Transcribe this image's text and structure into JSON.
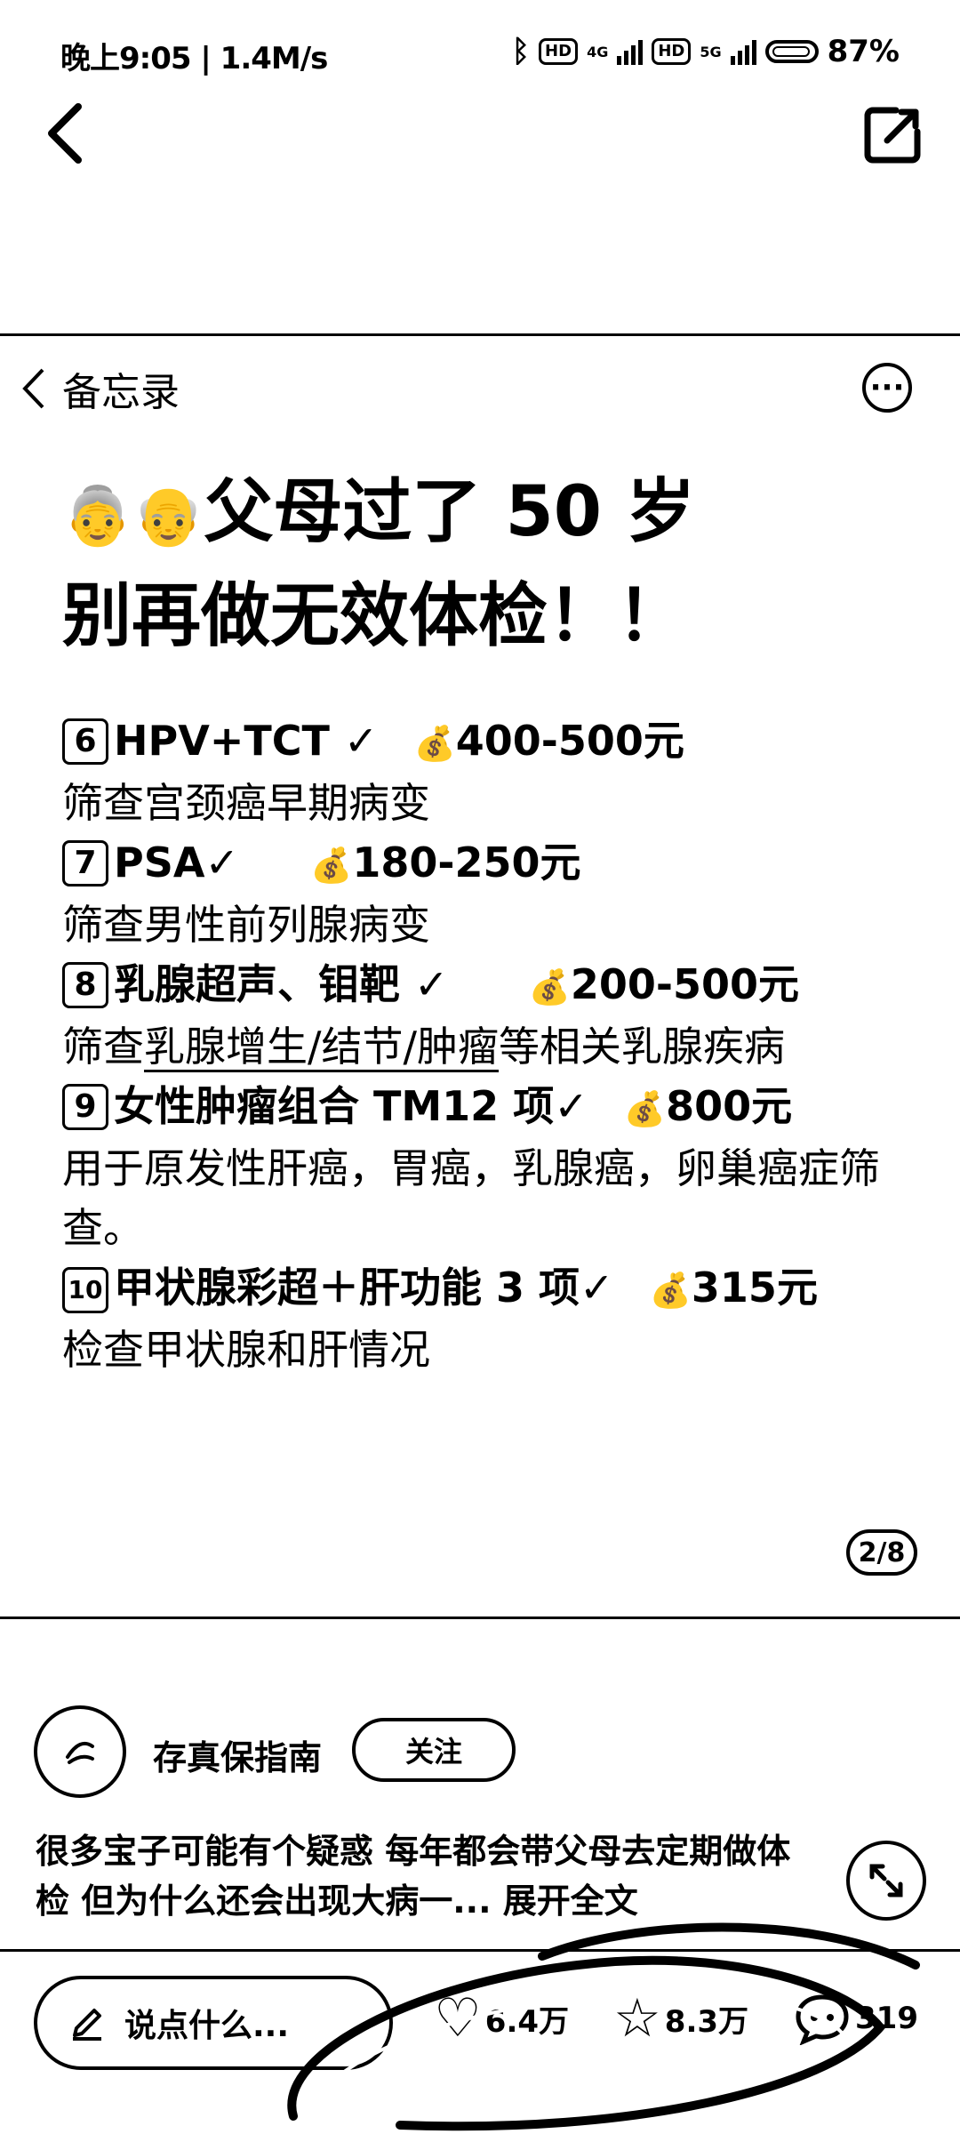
{
  "status_bar": {
    "time": "晚上9:05 | 1.4M/s",
    "network_1": "4G",
    "network_2": "5G",
    "battery": "87%"
  },
  "memo": {
    "back_label": "备忘录",
    "more_label": "···",
    "title_line1_emoji": "👵👴",
    "title_line1": "父母过了 50 岁",
    "title_line2": "别再做无效体检！！",
    "items": [
      {
        "num": "6",
        "name": "HPV+TCT ✓",
        "price": "400-500元",
        "desc": "筛查宫颈癌早期病变"
      },
      {
        "num": "7",
        "name": "PSA✓",
        "price": "180-250元",
        "desc": "筛查男性前列腺病变"
      },
      {
        "num": "8",
        "name": "乳腺超声、钼靶 ✓",
        "price": "200-500元",
        "desc_pre": "筛查",
        "desc_ul": "乳腺增生/结节/肿瘤",
        "desc_post": "等相关乳腺疾病"
      },
      {
        "num": "9",
        "name": "女性肿瘤组合 TM12 项✓",
        "price": "800元",
        "desc": "用于原发性肝癌，胃癌，乳腺癌，卵巢癌症筛查。"
      },
      {
        "num": "10",
        "name": "甲状腺彩超＋肝功能 3 项✓",
        "price": "315元",
        "desc": "检查甲状腺和肝情况"
      }
    ],
    "pager": "2/8"
  },
  "author": {
    "name": "存真保指南",
    "follow_label": "关注"
  },
  "description": {
    "text": "很多宝子可能有个疑惑 每年都会带父母去定期做体检 但为什么还会出现大病一... 展开全文"
  },
  "bottom_bar": {
    "comment_placeholder": "说点什么...",
    "likes": "6.4万",
    "favorites": "8.3万",
    "comments": "319"
  }
}
